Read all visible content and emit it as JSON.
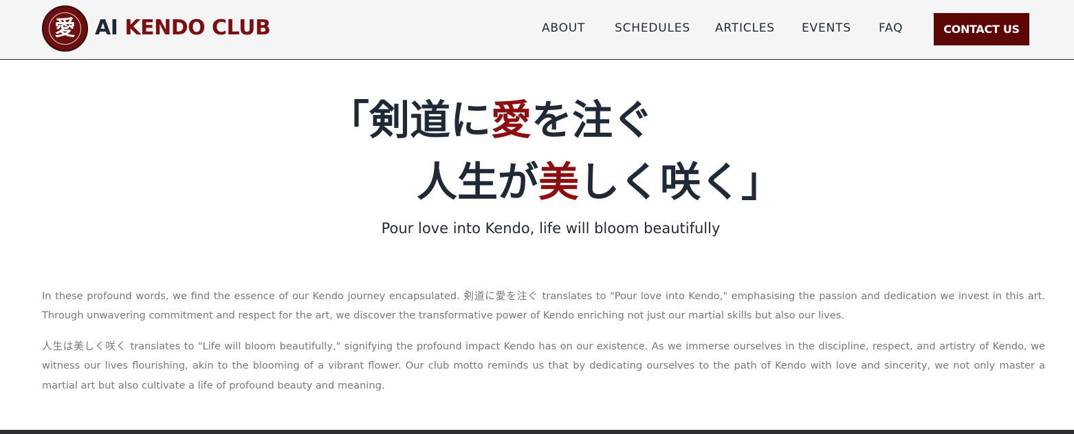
{
  "header": {
    "logo_char": "愛",
    "brand_ai": "AI",
    "brand_rest": "KENDO CLUB",
    "nav": [
      {
        "label": "ABOUT"
      },
      {
        "label": "SCHEDULES"
      },
      {
        "label": "ARTICLES"
      },
      {
        "label": "EVENTS"
      },
      {
        "label": "FAQ"
      }
    ],
    "contact_label": "CONTACT US"
  },
  "hero": {
    "line1_a": "「剣道に",
    "line1_red": "愛",
    "line1_b": "を注ぐ",
    "line2_a": "人生が",
    "line2_red": "美",
    "line2_b": "しく咲く」",
    "subtitle": "Pour love into Kendo, life will bloom beautifully"
  },
  "body": {
    "paragraph1": "In these profound words, we find the essence of our Kendo journey encapsulated. 剣道に愛を注ぐ translates to \"Pour love into Kendo,\" emphasising the passion and dedication we invest in this art. Through unwavering commitment and respect for the art, we discover the transformative power of Kendo enriching not just our martial skills but also our lives.",
    "paragraph2": "人生は美しく咲く translates to \"Life will bloom beautifully,\" signifying the profound impact Kendo has on our existence. As we immerse ourselves in the discipline, respect, and artistry of Kendo, we witness our lives flourishing, akin to the blooming of a vibrant flower. Our club motto reminds us that by dedicating ourselves to the path of Kendo with love and sincerity, we not only master a martial art but also cultivate a life of profound beauty and meaning."
  },
  "colors": {
    "accent": "#7c0f12",
    "contact_bg": "#5c0606",
    "hero_red": "#8e0f12",
    "text_dark": "#1f2a36",
    "text_muted": "#76787c"
  }
}
